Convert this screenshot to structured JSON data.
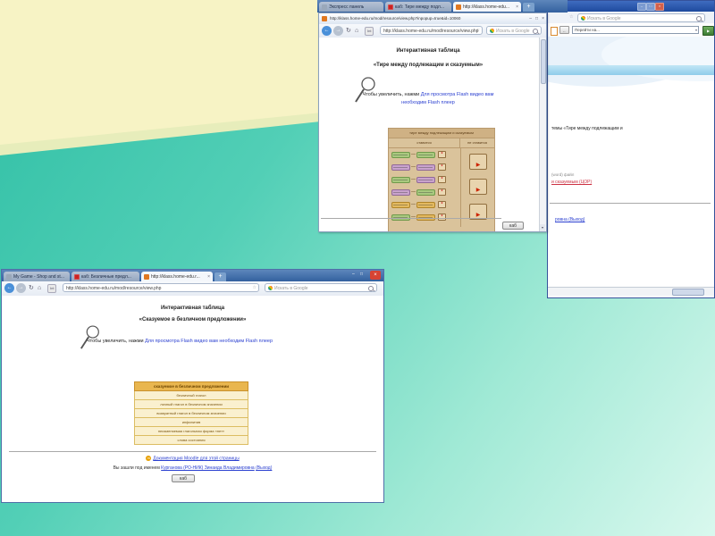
{
  "slide": {
    "background": {
      "teal_gradient": [
        "#2fbfa5",
        "#d9f8ee"
      ],
      "yellow": "#f7f3c5",
      "transition_band": "#e7edbb"
    }
  },
  "glyphs": {
    "minimize": "–",
    "maximize": "□",
    "close": "×",
    "tab_close": "×",
    "new_tab": "+",
    "back": "←",
    "forward": "→",
    "refresh": "↻",
    "home": "⌂",
    "star": "☆",
    "dropdown": "▾",
    "go": "▶",
    "dash": "—",
    "scroll_down": "▾",
    "play": "▶",
    "marker": "*",
    "moodle": "m"
  },
  "icons": {
    "google-icon": "four-color circle",
    "search-icon": "magnifier",
    "magnifier-icon": "hand-drawn magnifying glass",
    "tab-favicon-red": "red site icon",
    "tab-favicon-orange": "orange page icon",
    "moodle-doc-icon": "orange circle m"
  },
  "windows": {
    "top": {
      "tabs": [
        {
          "label": "Экспресс панель"
        },
        {
          "label": "каб: Тире между подл..."
        },
        {
          "label": "http://klass.home-edu..."
        }
      ],
      "popup": {
        "title": "http://klass.home-edu.ru/mod/resource/view.php?inpopup=true&id=10060",
        "toolbar": {
          "url": "http://klass.home-edu.ru/mod/resource/view.php",
          "badge": "Int",
          "search_placeholder": "Искать в Google"
        },
        "page": {
          "title": "Интерактивная таблица",
          "subtitle": "«Тире между подлежащим и сказуемым»",
          "caption_text": "Чтобы увеличить, нажми",
          "caption_link_line1": "Для просмотра Flash видео вам",
          "caption_link_line2": "необходим Flash плеер",
          "footer_button": "каб"
        },
        "flash_table": {
          "title": "тире между подлежащим и сказуемым",
          "col_left": "ставится",
          "col_right": "не ставится",
          "row_pairs": [
            [
              "green",
              "green"
            ],
            [
              "purple",
              "purple"
            ],
            [
              "green",
              "purple"
            ],
            [
              "purple",
              "green"
            ],
            [
              "orange",
              "orange"
            ],
            [
              "green",
              "orange"
            ]
          ],
          "video_buttons": 3,
          "colors": {
            "green": "#a9c97f",
            "purple": "#c9a3cc",
            "orange": "#e3b95f",
            "background": "#dac39b",
            "header": "#cfb184"
          }
        }
      }
    },
    "right": {
      "search_placeholder": "Искать в Google",
      "jump_label": "Перейти на...",
      "page": {
        "heading_fragment": "темы «Тире между подлежащим и",
        "meta_fragment": "(word) файл",
        "resource_link_fragment": "и сказуемым (ЦОР)",
        "login_fragment": "ровна (Выход)"
      }
    },
    "bottom": {
      "tabs": [
        {
          "label": "My Game - Shop and st..."
        },
        {
          "label": "каб: Безличные предл..."
        },
        {
          "label": "http://klass.home-edu.r..."
        }
      ],
      "toolbar": {
        "url": "http://klass.home-edu.ru/mod/resource/view.php",
        "badge": "Int",
        "search_placeholder": "Искать в Google"
      },
      "page": {
        "title": "Интерактивная таблица",
        "subtitle": "«Сказуемое в безличном предложении»",
        "caption_text": "Чтобы увеличить, нажми",
        "caption_link": "Для просмотра Flash видео вам необходим Flash плеер",
        "table": {
          "header": "сказуемое в безличном предложении",
          "rows": [
            "безличный глагол",
            "личный глагол в безличном значении",
            "возвратный глагол в безличном значении",
            "инфинитив",
            "неизменяемая глагольная форма «нет»",
            "слова состояния"
          ]
        },
        "docs_link": "Документация Moodle для этой страницы",
        "login_prefix": "Вы зашли под именем",
        "login_name": "Курганова (РО-НИК) Зинаида Владимировна",
        "logout_link": "(Выход)",
        "footer_button": "каб"
      }
    }
  }
}
